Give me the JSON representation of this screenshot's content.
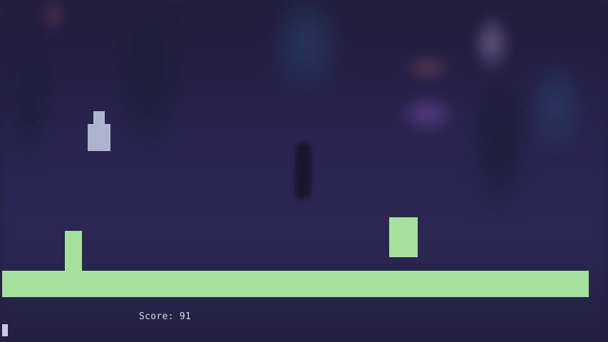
{
  "hud": {
    "score_label": "Score:",
    "score_value": "91"
  },
  "colors": {
    "platform": "#a5e09c",
    "player": "#aeb3d0",
    "text": "#d6d6e6",
    "cursor": "#c9c6ea",
    "background": "#252042"
  }
}
